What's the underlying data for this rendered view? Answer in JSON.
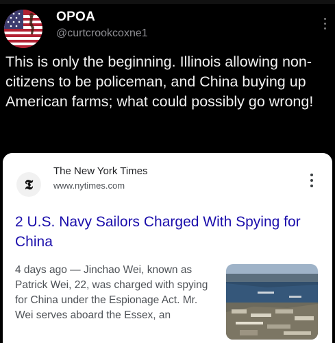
{
  "tweet": {
    "display_name": "OPOA",
    "handle": "@curtcrookcoxne1",
    "text": "This is only the beginning. Illinois allowing non-citizens to be policeman, and China buying up American farms; what could possibly go wrong!",
    "avatar_icon": "american-flag-avatar-icon",
    "more_icon": "more-vertical-icon"
  },
  "card": {
    "source_logo_glyph": "𝕿",
    "source_name": "The New York Times",
    "source_url": "www.nytimes.com",
    "headline": "2 U.S. Navy Sailors Charged With Spying for China",
    "snippet": "4 days ago — Jinchao Wei, known as Patrick Wei, 22, was charged with spying for China under the Espionage Act. Mr. Wei serves aboard the Essex, an",
    "more_icon": "more-vertical-icon",
    "thumbnail_icon": "harbor-aerial-photo"
  },
  "colors": {
    "background": "#000000",
    "headline_link": "#1a0dab",
    "handle_gray": "#8e8e93"
  }
}
